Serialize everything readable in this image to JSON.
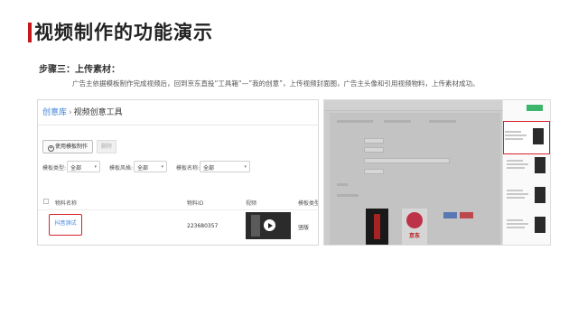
{
  "slide": {
    "title": "视频制作的功能演示",
    "accent_color": "#c8161d",
    "step": "步骤三：上传素材：",
    "description": "广告主依据模板制作完成视频后，回到京东直投“工具箱“—”我的创意”，上传视频封面图，广告主头像和引用视频物料，上传素材成功。"
  },
  "left_panel": {
    "breadcrumb_root": "创意库",
    "breadcrumb_sep": "›",
    "breadcrumb_current": "视频创意工具",
    "use_template_button": "使用模板制作",
    "delete_button": "删除",
    "filters": [
      {
        "label": "模板类型:",
        "value": "全部"
      },
      {
        "label": "模板风格:",
        "value": "全部"
      },
      {
        "label": "模板名称:",
        "value": "全部"
      }
    ],
    "table_headers": [
      "物料名称",
      "物料ID",
      "视频",
      "模板类型"
    ],
    "rows": [
      {
        "name": "抖音测试",
        "id": "223680357",
        "template_type": "竖版"
      }
    ]
  },
  "right_panel": {
    "poster_text": "京东",
    "icons": [
      "play-icon",
      "circle-plus-icon",
      "chevron-down-icon",
      "checkbox-icon"
    ],
    "colors": {
      "highlight": "#d8232a",
      "link": "#3b7fd6",
      "green": "#3bb56c"
    }
  }
}
